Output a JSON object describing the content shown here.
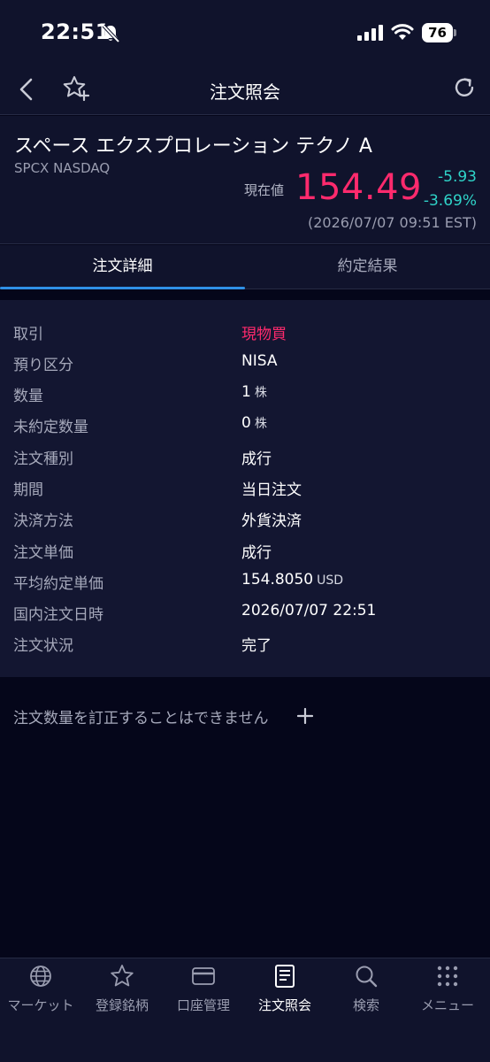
{
  "status_bar": {
    "time": "22:51",
    "battery": "76"
  },
  "nav": {
    "title": "注文照会"
  },
  "stock": {
    "name": "スペース エクスプロレーション テクノ A",
    "ticker": "SPCX NASDAQ",
    "price_label": "現在値",
    "price": "154.49",
    "change_abs": "-5.93",
    "change_pct": "-3.69%",
    "timestamp": "(2026/07/07 09:51 EST)"
  },
  "tabs": [
    {
      "label": "注文詳細",
      "active": true
    },
    {
      "label": "約定結果",
      "active": false
    }
  ],
  "details": [
    {
      "label": "取引",
      "value": "現物買",
      "unit": ""
    },
    {
      "label": "預り区分",
      "value": "NISA",
      "unit": ""
    },
    {
      "label": "数量",
      "value": "1",
      "unit": "株"
    },
    {
      "label": "未約定数量",
      "value": "0",
      "unit": "株"
    },
    {
      "label": "注文種別",
      "value": "成行",
      "unit": ""
    },
    {
      "label": "期間",
      "value": "当日注文",
      "unit": ""
    },
    {
      "label": "決済方法",
      "value": "外貨決済",
      "unit": ""
    },
    {
      "label": "注文単価",
      "value": "成行",
      "unit": ""
    },
    {
      "label": "平均約定単価",
      "value": "154.8050",
      "unit": "USD"
    },
    {
      "label": "国内注文日時",
      "value": "2026/07/07 22:51",
      "unit": ""
    },
    {
      "label": "注文状況",
      "value": "完了",
      "unit": ""
    }
  ],
  "note": "注文数量を訂正することはできません",
  "tabbar": [
    {
      "label": "マーケット",
      "icon": "globe-icon",
      "active": false
    },
    {
      "label": "登録銘柄",
      "icon": "star-icon",
      "active": false
    },
    {
      "label": "口座管理",
      "icon": "card-icon",
      "active": false
    },
    {
      "label": "注文照会",
      "icon": "document-icon",
      "active": true
    },
    {
      "label": "検索",
      "icon": "search-icon",
      "active": false
    },
    {
      "label": "メニュー",
      "icon": "grid-menu-icon",
      "active": false
    }
  ],
  "colors": {
    "price_down": "#ff2a6d",
    "change": "#2fd3c8",
    "tab_accent": "#2f90e6"
  }
}
